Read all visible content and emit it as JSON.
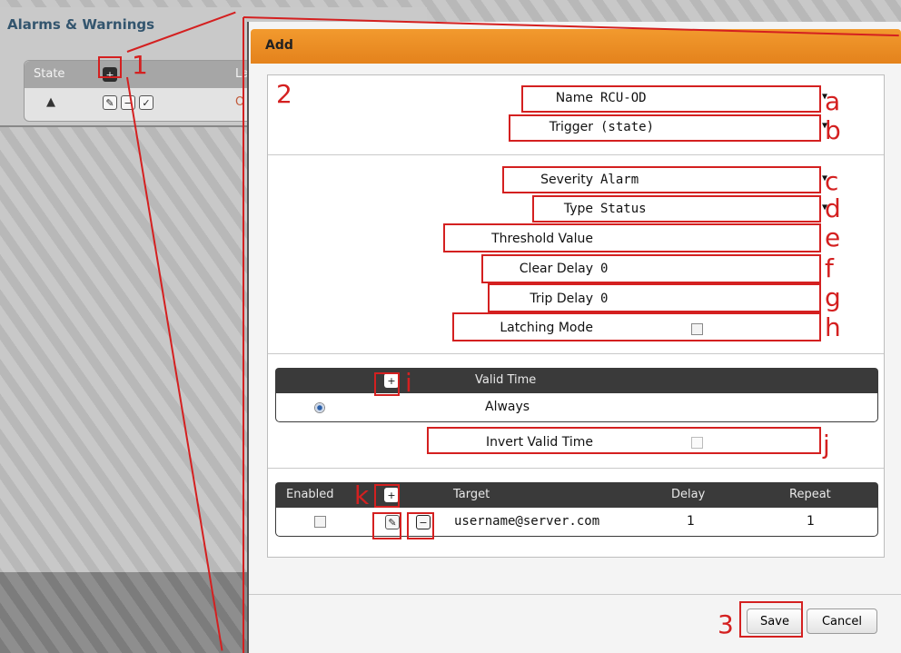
{
  "background": {
    "panel_title": "Alarms & Warnings",
    "col_state": "State",
    "col_la": "La",
    "row_value": "O"
  },
  "dialog": {
    "title": "Add",
    "fields": {
      "name_label": "Name",
      "name_value": "RCU-OD",
      "trigger_label": "Trigger",
      "trigger_value": "(state)",
      "severity_label": "Severity",
      "severity_value": "Alarm",
      "type_label": "Type",
      "type_value": "Status",
      "threshold_label": "Threshold Value",
      "threshold_value": "",
      "clear_delay_label": "Clear Delay",
      "clear_delay_value": "0",
      "trip_delay_label": "Trip Delay",
      "trip_delay_value": "0",
      "latching_label": "Latching Mode"
    },
    "valid_time": {
      "header": "Valid Time",
      "row_value": "Always",
      "invert_label": "Invert Valid Time"
    },
    "targets": {
      "columns": [
        "Enabled",
        "Target",
        "Delay",
        "Repeat"
      ],
      "row": {
        "target": "username@server.com",
        "delay": "1",
        "repeat": "1"
      }
    },
    "buttons": {
      "save": "Save",
      "cancel": "Cancel"
    }
  },
  "annotations": {
    "n1": "1",
    "n2": "2",
    "n3": "3",
    "a": "a",
    "b": "b",
    "c": "c",
    "d": "d",
    "e": "e",
    "f": "f",
    "g": "g",
    "h": "h",
    "i": "i",
    "j": "j",
    "k": "k"
  },
  "colors": {
    "header_orange": "#e98a22",
    "annotation_red": "#d42020",
    "table_header": "#3a3a3a"
  }
}
